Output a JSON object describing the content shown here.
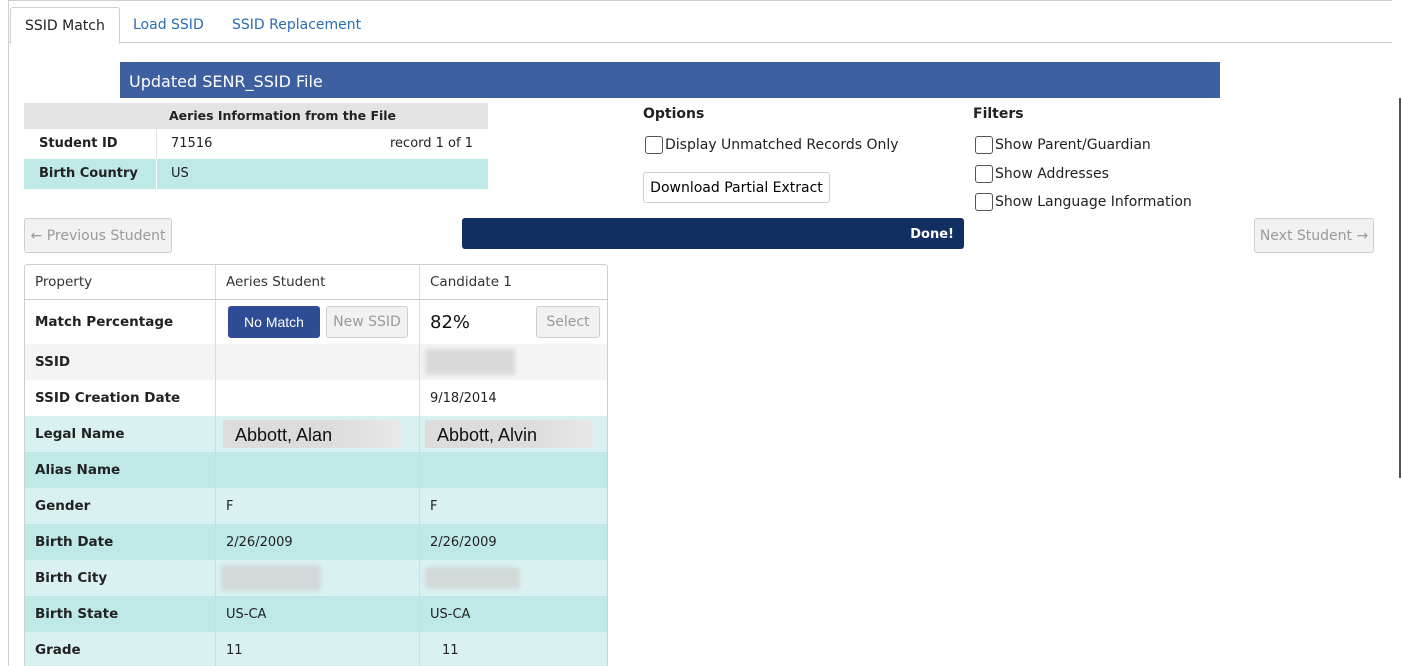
{
  "tabs": [
    {
      "label": "SSID Match",
      "active": true
    },
    {
      "label": "Load SSID",
      "active": false
    },
    {
      "label": "SSID Replacement",
      "active": false
    }
  ],
  "banner": {
    "title": "Updated SENR_SSID File"
  },
  "file_info": {
    "header": "Aeries Information from the File",
    "student_id_label": "Student ID",
    "student_id": "71516",
    "record": "record 1 of 1",
    "birth_country_label": "Birth Country",
    "birth_country": "US"
  },
  "options": {
    "title": "Options",
    "unmatched_only": "Display Unmatched Records Only",
    "download_button": "Download Partial Extract"
  },
  "filters": {
    "title": "Filters",
    "items": [
      "Show Parent/Guardian",
      "Show Addresses",
      "Show Language Information"
    ]
  },
  "nav": {
    "prev": "← Previous Student",
    "next": "Next Student →",
    "progress_text": "Done!",
    "progress_percent": 100
  },
  "grid": {
    "headers": [
      "Property",
      "Aeries Student",
      "Candidate 1"
    ],
    "match": {
      "label": "Match Percentage",
      "no_match": "No Match",
      "new_ssid": "New SSID",
      "percent": "82%",
      "select": "Select"
    },
    "rows": [
      {
        "label": "SSID",
        "a": "",
        "c": ""
      },
      {
        "label": "SSID Creation Date",
        "a": "",
        "c": "9/18/2014"
      },
      {
        "label": "Legal Name",
        "a": "Abbott, Alan",
        "c": "Abbott, Alvin"
      },
      {
        "label": "Alias Name",
        "a": "",
        "c": ""
      },
      {
        "label": "Gender",
        "a": "F",
        "c": "F"
      },
      {
        "label": "Birth Date",
        "a": "2/26/2009",
        "c": "2/26/2009"
      },
      {
        "label": "Birth City",
        "a": "",
        "c": ""
      },
      {
        "label": "Birth State",
        "a": "US-CA",
        "c": "US-CA"
      },
      {
        "label": "Grade",
        "a": "11",
        "c": "11"
      }
    ]
  },
  "colors": {
    "banner": "#3e5fa0",
    "progress": "#122f62",
    "primary_button": "#2d4c93",
    "teal_dark": "#bfe9e7",
    "teal_light": "#d9f2f1",
    "link": "#2a6db5"
  }
}
